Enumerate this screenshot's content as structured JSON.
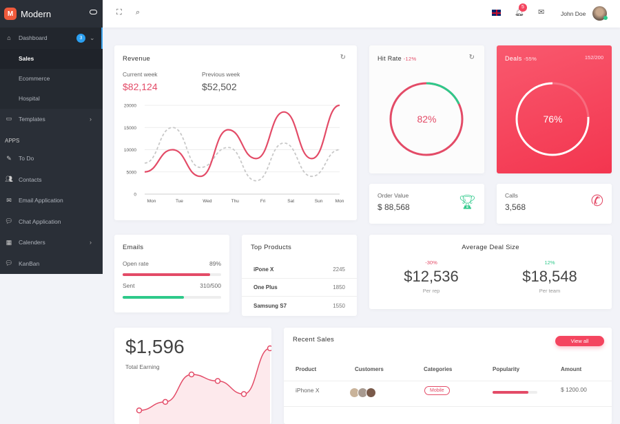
{
  "app": {
    "name": "Modern",
    "logo_letter": "M"
  },
  "sidebar": {
    "items": [
      {
        "label": "Dashboard",
        "icon": "home-icon",
        "badge": "3"
      },
      {
        "label": "Templates",
        "icon": "monitor-icon"
      }
    ],
    "dashboard_sub": [
      "Sales",
      "Ecommerce",
      "Hospital"
    ],
    "section": "APPS",
    "apps": [
      {
        "label": "To Do",
        "icon": "edit-icon"
      },
      {
        "label": "Contacts",
        "icon": "users-icon"
      },
      {
        "label": "Email Application",
        "icon": "mail-icon"
      },
      {
        "label": "Chat Application",
        "icon": "chat-icon"
      },
      {
        "label": "Calenders",
        "icon": "calendar-icon"
      },
      {
        "label": "KanBan",
        "icon": "chat-icon"
      }
    ]
  },
  "header": {
    "notifications": "5",
    "user": "John Doe"
  },
  "revenue": {
    "title": "Revenue",
    "current_label": "Current week",
    "current": "$82,124",
    "previous_label": "Previous week",
    "previous": "$52,502"
  },
  "chart_data": [
    {
      "type": "line",
      "categories": [
        "Mon",
        "Tue",
        "Wed",
        "Thu",
        "Fri",
        "Sat",
        "Sun",
        "Mon"
      ],
      "ylim": [
        0,
        20000
      ],
      "yticks": [
        "20000",
        "15000",
        "10000",
        "5000",
        "0"
      ],
      "grid": true,
      "series": [
        {
          "values": [
            5000,
            10000,
            4000,
            14500,
            8000,
            18500,
            8000,
            20000
          ],
          "color": "#e34b67",
          "style": "solid"
        },
        {
          "values": [
            7000,
            15000,
            6000,
            10500,
            3000,
            11500,
            4000,
            10000
          ],
          "color": "#c8c8c8",
          "style": "dashed"
        }
      ]
    },
    {
      "type": "area",
      "values": [
        5,
        18,
        60,
        50,
        30,
        100
      ],
      "color": "#e34b67"
    }
  ],
  "hit_rate": {
    "title": "Hit Rate",
    "change": "-12%",
    "value": "82%",
    "percent": 82
  },
  "deals": {
    "title": "Deals",
    "change": "-55%",
    "count": "152/200",
    "value": "76%",
    "percent": 76
  },
  "order_value": {
    "label": "Order Value",
    "value": "$ 88,568"
  },
  "calls": {
    "label": "Calls",
    "value": "3,568"
  },
  "emails": {
    "title": "Emails",
    "open_label": "Open rate",
    "open_value": "89%",
    "open_pct": 89,
    "sent_label": "Sent",
    "sent_value": "310/500",
    "sent_pct": 62
  },
  "top_products": {
    "title": "Top Products",
    "rows": [
      {
        "name": "iPone X",
        "value": "2245"
      },
      {
        "name": "One Plus",
        "value": "1850"
      },
      {
        "name": "Samsung S7",
        "value": "1550"
      }
    ]
  },
  "avg_deal": {
    "title": "Average Deal Size",
    "rep": {
      "change": "-30%",
      "value": "$12,536",
      "label": "Per rep"
    },
    "team": {
      "change": "12%",
      "value": "$18,548",
      "label": "Per team"
    }
  },
  "earning": {
    "value": "$1,596",
    "label": "Total Earning"
  },
  "recent_sales": {
    "title": "Recent Sales",
    "view_all": "View all",
    "columns": [
      "Product",
      "Customers",
      "Categories",
      "Popularity",
      "Amount"
    ],
    "rows": [
      {
        "product": "iPhone X",
        "category": "Mobile",
        "popularity": 80,
        "amount": "$ 1200.00"
      }
    ]
  },
  "colors": {
    "accent": "#e34b67",
    "green": "#2ec98a",
    "sidebar": "#2a2f37"
  }
}
